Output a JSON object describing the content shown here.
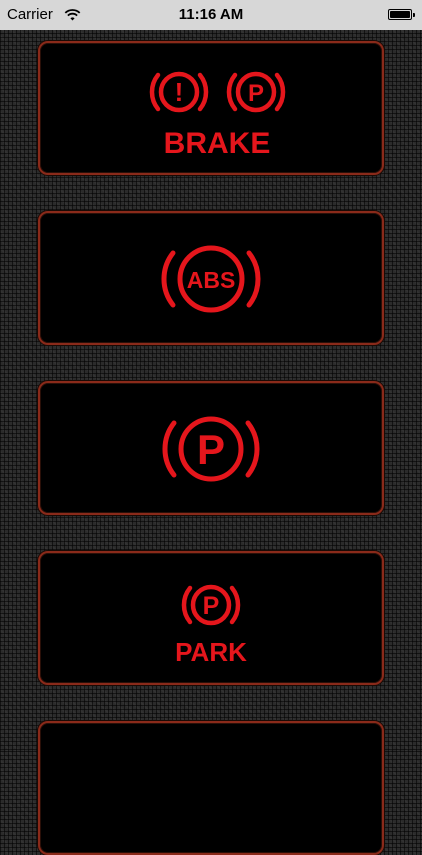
{
  "status_bar": {
    "carrier": "Carrier",
    "time": "11:16 AM",
    "icons": [
      "wifi-icon",
      "battery-icon"
    ]
  },
  "colors": {
    "lamp_red": "#e5161c",
    "card_border": "#8a2a1a",
    "card_bg": "#000000",
    "status_bg": "#d7d7d7"
  },
  "cards": [
    {
      "icons": [
        "brake-warning-exclamation-icon",
        "parking-brake-p-icon"
      ],
      "glyph_exclaim": "!",
      "glyph_p": "P",
      "label": "BRAKE"
    },
    {
      "icons": [
        "abs-warning-icon"
      ],
      "glyph": "ABS"
    },
    {
      "icons": [
        "parking-brake-icon"
      ],
      "glyph": "P"
    },
    {
      "icons": [
        "park-brake-icon"
      ],
      "glyph": "P",
      "label": "PARK"
    }
  ]
}
